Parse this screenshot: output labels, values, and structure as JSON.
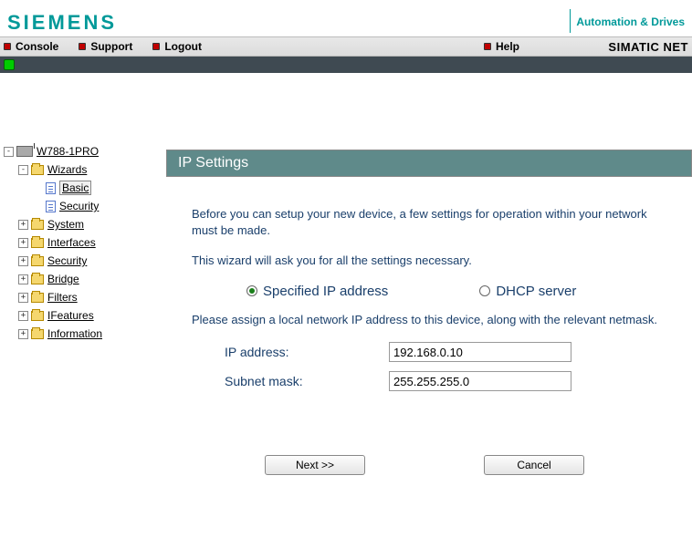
{
  "header": {
    "logo": "SIEMENS",
    "tagline": "Automation & Drives"
  },
  "toolbar": {
    "items": [
      "Console",
      "Support",
      "Logout"
    ],
    "help": "Help",
    "brand": "SIMATIC NET"
  },
  "tree": {
    "device": "W788-1PRO",
    "wizards": "Wizards",
    "wizard_items": {
      "basic": "Basic",
      "security": "Security"
    },
    "nodes": [
      "System",
      "Interfaces",
      "Security",
      "Bridge",
      "Filters",
      "IFeatures",
      "Information"
    ]
  },
  "panel": {
    "title": "IP Settings",
    "intro1": "Before you can setup your new device, a few settings for operation within your network must be made.",
    "intro2": "This wizard will ask you for all the settings necessary.",
    "radio_specified": "Specified IP address",
    "radio_dhcp": "DHCP server",
    "assign_text": "Please assign a local network IP address to this device, along with the relevant netmask.",
    "ip_label": "IP address:",
    "ip_value": "192.168.0.10",
    "mask_label": "Subnet mask:",
    "mask_value": "255.255.255.0",
    "next": "Next >>",
    "cancel": "Cancel"
  }
}
